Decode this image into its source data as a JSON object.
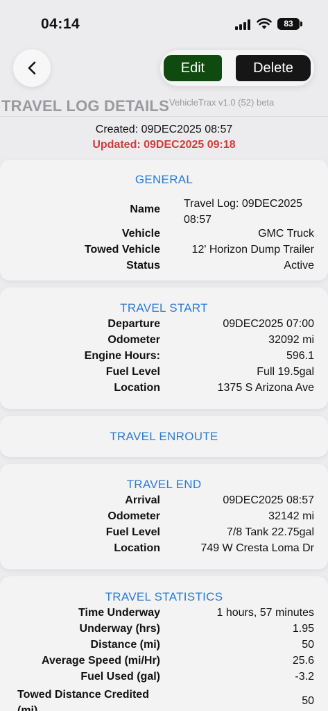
{
  "status_bar": {
    "time": "04:14",
    "battery": "83"
  },
  "toolbar": {
    "edit_label": "Edit",
    "delete_label": "Delete"
  },
  "header": {
    "title": "TRAVEL LOG DETAILS",
    "version": "VehicleTrax v1.0 (52) beta"
  },
  "meta": {
    "created": "Created: 09DEC2025 08:57",
    "updated": "Updated: 09DEC2025 09:18"
  },
  "colors": {
    "accent_blue": "#2a7bd4",
    "updated_red": "#d33a3a",
    "edit_green": "#0f4a0f",
    "delete_black": "#161616"
  },
  "general": {
    "title": "GENERAL",
    "name_label": "Name",
    "name_value": "Travel Log: 09DEC2025 08:57",
    "vehicle_label": "Vehicle",
    "vehicle_value": "GMC Truck",
    "towed_label": "Towed Vehicle",
    "towed_value": "12' Horizon Dump Trailer",
    "status_label": "Status",
    "status_value": "Active"
  },
  "travel_start": {
    "title": "TRAVEL START",
    "rows": [
      {
        "label": "Departure",
        "value": "09DEC2025 07:00"
      },
      {
        "label": "Odometer",
        "value": "32092 mi"
      },
      {
        "label": "Engine Hours:",
        "value": "596.1"
      },
      {
        "label": "Fuel Level",
        "value": "Full 19.5gal"
      },
      {
        "label": "Location",
        "value": "1375 S Arizona Ave"
      }
    ]
  },
  "travel_enroute": {
    "title": "TRAVEL ENROUTE"
  },
  "travel_end": {
    "title": "TRAVEL END",
    "rows": [
      {
        "label": "Arrival",
        "value": "09DEC2025 08:57"
      },
      {
        "label": "Odometer",
        "value": "32142 mi"
      },
      {
        "label": "Fuel Level",
        "value": "7/8 Tank 22.75gal"
      },
      {
        "label": "Location",
        "value": "749 W Cresta Loma Dr"
      }
    ]
  },
  "travel_statistics": {
    "title": "TRAVEL STATISTICS",
    "rows": [
      {
        "label": "Time Underway",
        "value": "1 hours, 57 minutes"
      },
      {
        "label": "Underway (hrs)",
        "value": "1.95"
      },
      {
        "label": "Distance (mi)",
        "value": "50"
      },
      {
        "label": "Average Speed (mi/Hr)",
        "value": "25.6"
      },
      {
        "label": "Fuel Used (gal)",
        "value": "-3.2"
      }
    ],
    "towed_label": "Towed Distance Credited (mi)",
    "towed_value": "50"
  }
}
